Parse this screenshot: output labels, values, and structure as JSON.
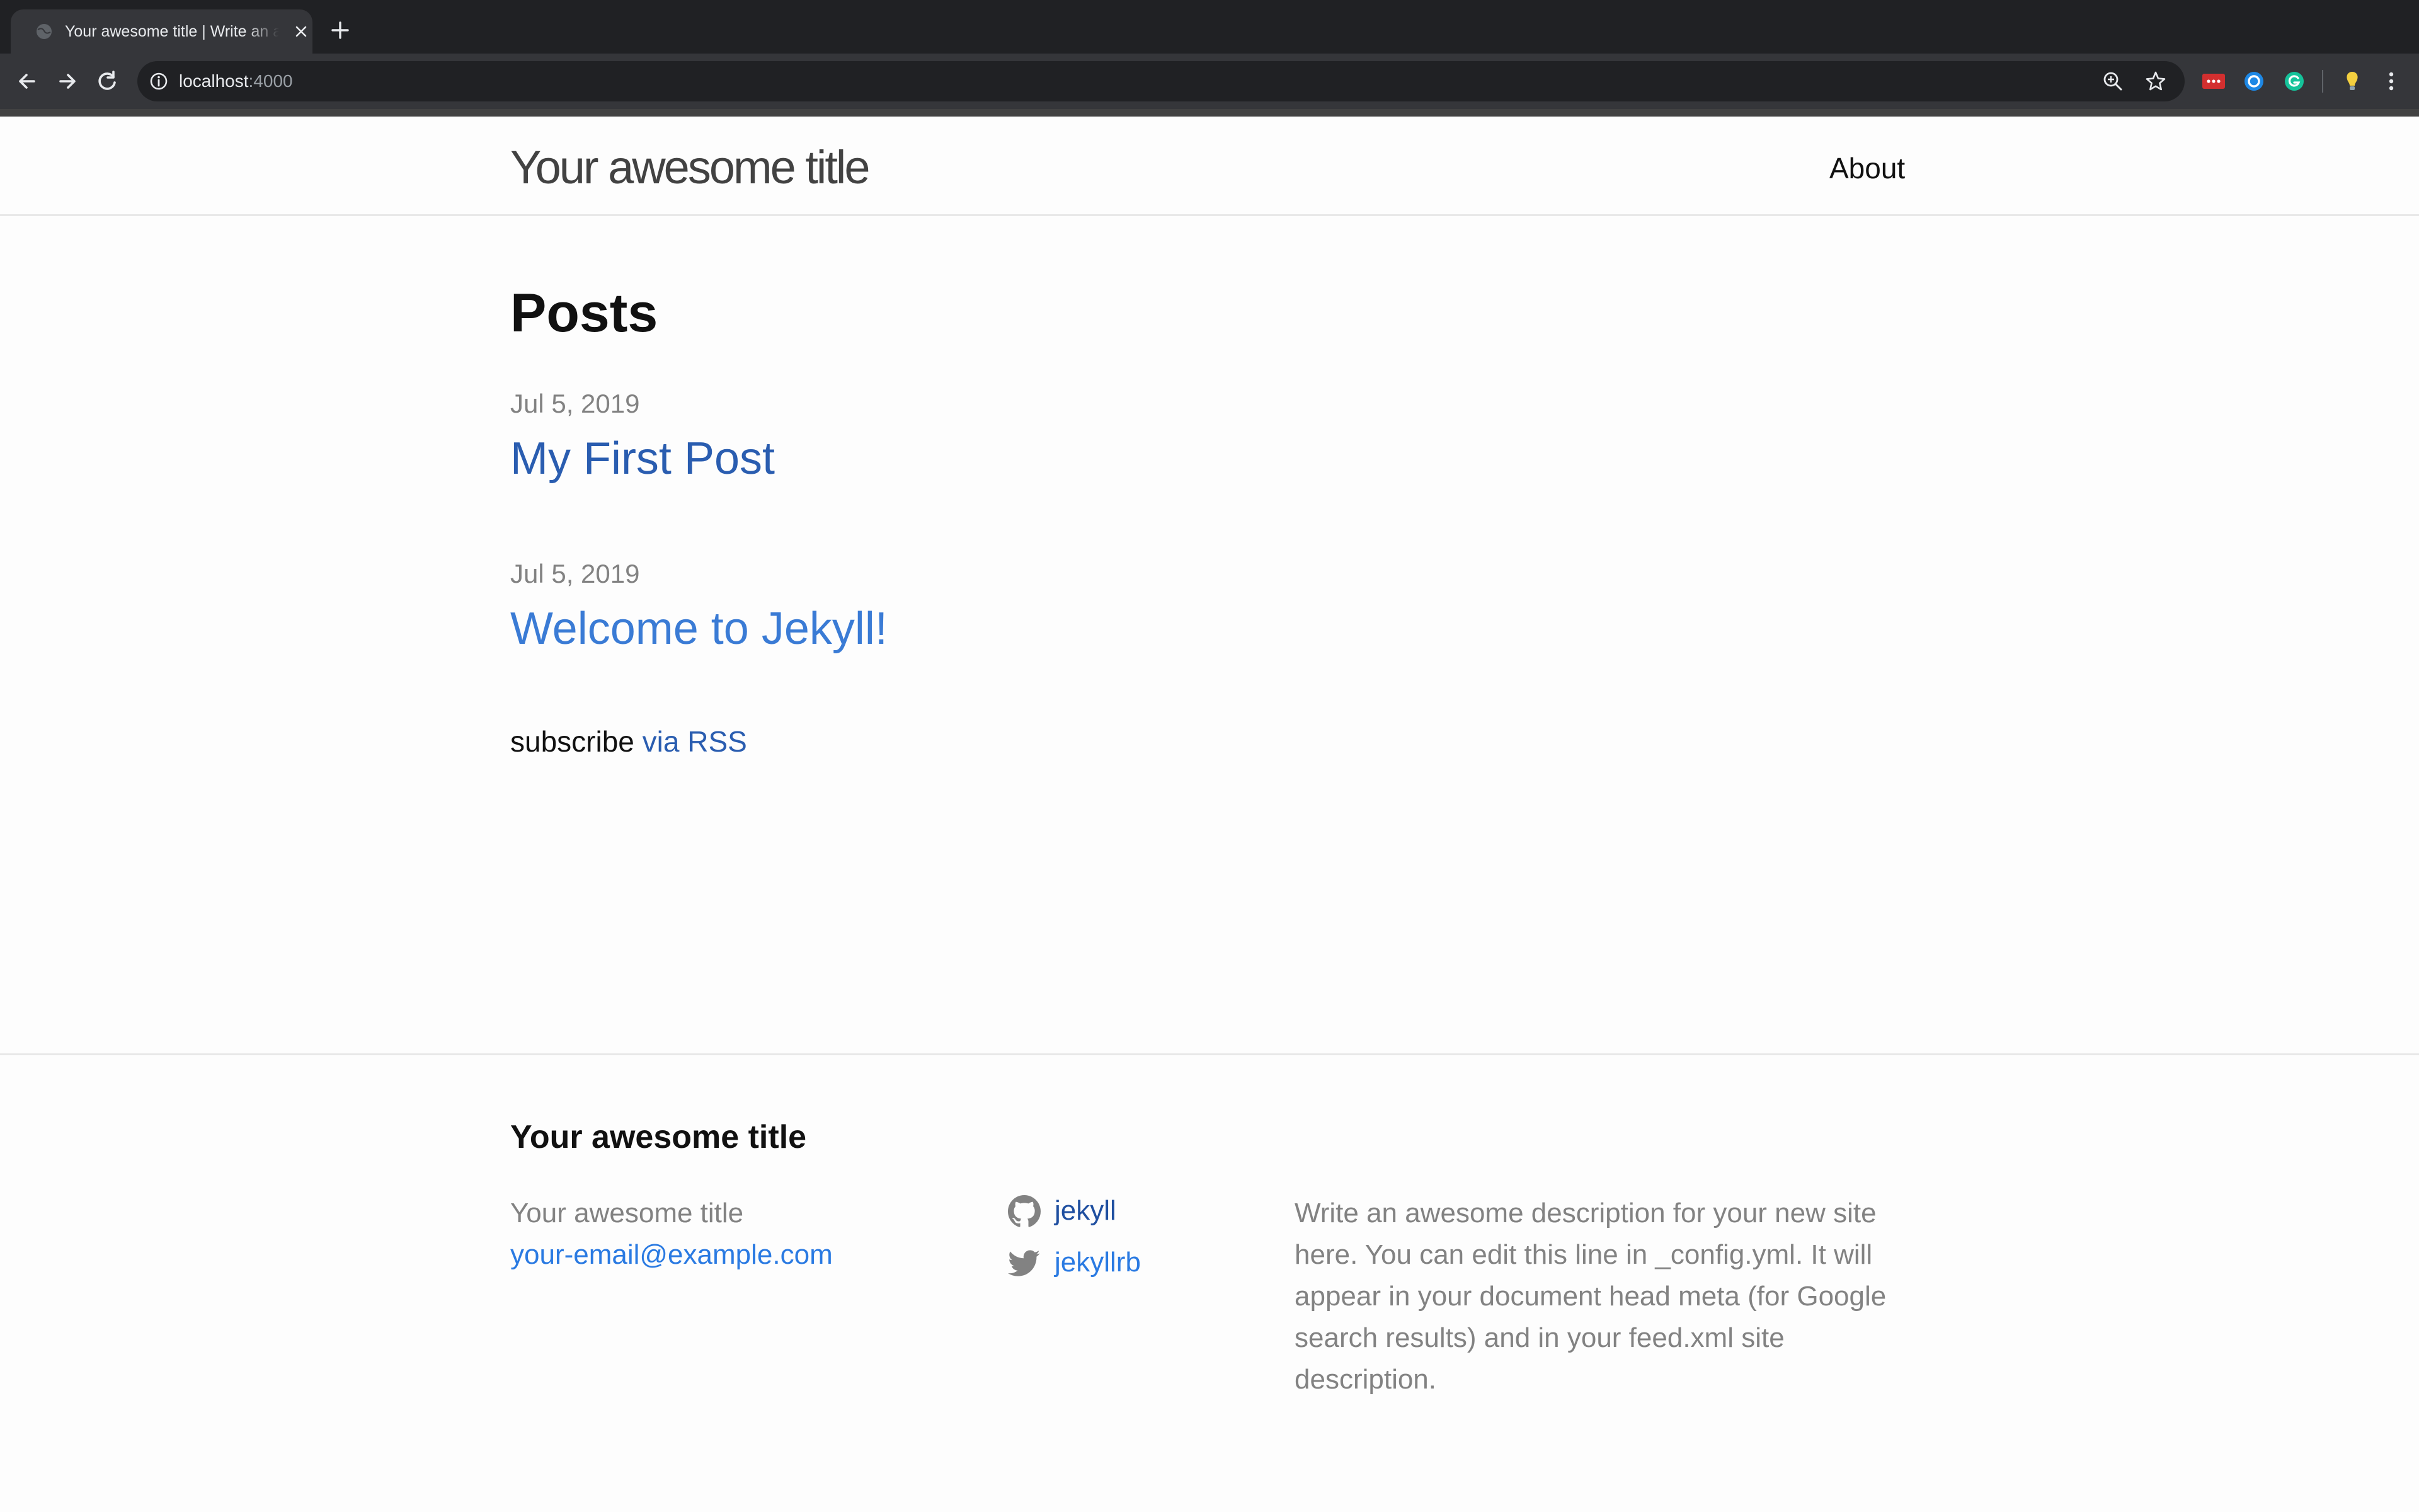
{
  "browser": {
    "tab_title": "Your awesome title | Write an awesome description",
    "url_host": "localhost",
    "url_port": ":4000"
  },
  "header": {
    "site_title": "Your awesome title",
    "nav_about": "About"
  },
  "main": {
    "heading": "Posts",
    "posts": [
      {
        "date": "Jul 5, 2019",
        "title": "My First Post"
      },
      {
        "date": "Jul 5, 2019",
        "title": "Welcome to Jekyll!"
      }
    ],
    "subscribe_text": "subscribe",
    "rss_link": "via RSS"
  },
  "footer": {
    "heading": "Your awesome title",
    "name": "Your awesome title",
    "email": "your-email@example.com",
    "github": "jekyll",
    "twitter": "jekyllrb",
    "description": "Write an awesome description for your new site here. You can edit this line in _config.yml. It will appear in your document head meta (for Google search results) and in your feed.xml site description."
  },
  "colors": {
    "link": "#2a7ae2",
    "text": "#111111",
    "muted": "#828282",
    "chrome_bg": "#202124"
  }
}
